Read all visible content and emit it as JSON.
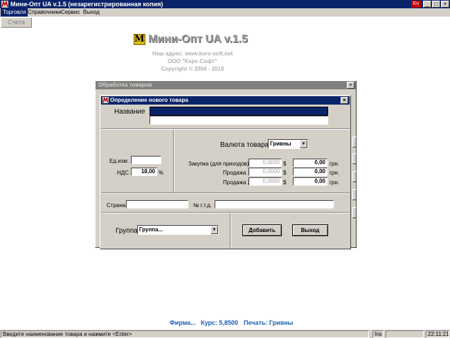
{
  "window": {
    "title": "Мини-Опт UA v.1.5 (незарегистрированная копия)",
    "lang": "En",
    "minimize_glyph": "_",
    "maximize_glyph": "□",
    "close_glyph": "×"
  },
  "menu": {
    "items": [
      {
        "label": "Торговля",
        "active": true
      },
      {
        "label": "Справочники"
      },
      {
        "label": "Сервис"
      },
      {
        "label": "Выход"
      }
    ]
  },
  "toolbar": {
    "accounts_label": "Счета"
  },
  "branding": {
    "logo_letter": "M",
    "title": "Мини-Опт UA v.1.5",
    "address": "Наш адрес: www.kors-soft.net",
    "company": "ООО \"Корс-Софт\"",
    "copyright": "Copyright © 2004 - 2010"
  },
  "background_window": {
    "title": "Обработка товаров",
    "close_glyph": "×"
  },
  "dialog": {
    "title": "Определение нового товара",
    "close_glyph": "×",
    "name_label": "Название",
    "name_value": "",
    "unit_label": "Ед.изм.",
    "unit_value": "",
    "vat_label": "НДС",
    "vat_value": "18,00",
    "vat_unit": "%",
    "currency_label": "Валюта товара",
    "currency_value": "Гривны",
    "purchase_label": "Закупка (для приходов)",
    "sale1_label": "Продажа 1",
    "sale2_label": "Продажа 2",
    "foreign_value": "0,0000",
    "foreign_symbol": "$",
    "local_value": "0,00",
    "local_unit": "грн.",
    "country_label": "Страна",
    "country_value": "",
    "customs_label": "№ г.т.д.",
    "customs_value": "",
    "group_label": "Группа",
    "group_value": "Группа...",
    "add_button": "Добавить",
    "exit_button": "Выход"
  },
  "info": {
    "firm": "Фирма...",
    "rate": "Курс: 5,8500",
    "print": "Печать: Гривны"
  },
  "status": {
    "hint": "Введите наименование товара и нажмите <Enter>",
    "mode": "Ins",
    "time": "22:11:21"
  },
  "colors": {
    "active_title": "#0a246a",
    "face": "#d4d0c8",
    "info_text": "#1f5fb0"
  }
}
